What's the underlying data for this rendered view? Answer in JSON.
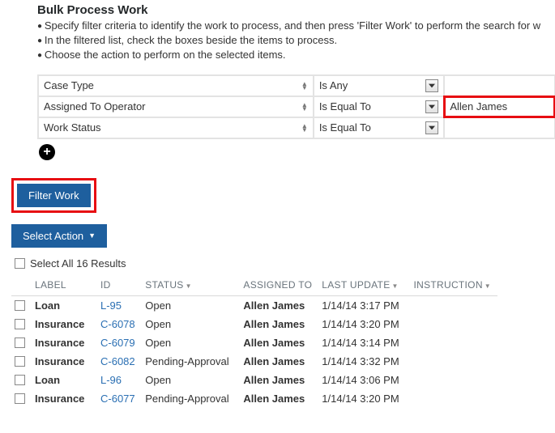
{
  "title": "Bulk Process Work",
  "instructions": [
    "Specify filter criteria to identify the work to process, and then press 'Filter Work' to perform the search for w",
    "In the filtered list, check the boxes beside the items to process.",
    "Choose the action to perform on the selected items."
  ],
  "filters": {
    "rows": [
      {
        "field": "Case Type",
        "op": "Is Any",
        "value": ""
      },
      {
        "field": "Assigned To Operator",
        "op": "Is Equal To",
        "value": "Allen James"
      },
      {
        "field": "Work Status",
        "op": "Is Equal To",
        "value": ""
      }
    ]
  },
  "buttons": {
    "filter_work": "Filter Work",
    "select_action": "Select Action"
  },
  "select_all_label": "Select All 16 Results",
  "columns": {
    "label": "LABEL",
    "id": "ID",
    "status": "STATUS",
    "assigned": "ASSIGNED TO",
    "updated": "LAST UPDATE",
    "instructions": "INSTRUCTION"
  },
  "rows": [
    {
      "label": "Loan",
      "id": "L-95",
      "status": "Open",
      "assigned": "Allen James",
      "updated": "1/14/14 3:17 PM"
    },
    {
      "label": "Insurance",
      "id": "C-6078",
      "status": "Open",
      "assigned": "Allen James",
      "updated": "1/14/14 3:20 PM"
    },
    {
      "label": "Insurance",
      "id": "C-6079",
      "status": "Open",
      "assigned": "Allen James",
      "updated": "1/14/14 3:14 PM"
    },
    {
      "label": "Insurance",
      "id": "C-6082",
      "status": "Pending-Approval",
      "assigned": "Allen James",
      "updated": "1/14/14 3:32 PM"
    },
    {
      "label": "Loan",
      "id": "L-96",
      "status": "Open",
      "assigned": "Allen James",
      "updated": "1/14/14 3:06 PM"
    },
    {
      "label": "Insurance",
      "id": "C-6077",
      "status": "Pending-Approval",
      "assigned": "Allen James",
      "updated": "1/14/14 3:20 PM"
    }
  ]
}
